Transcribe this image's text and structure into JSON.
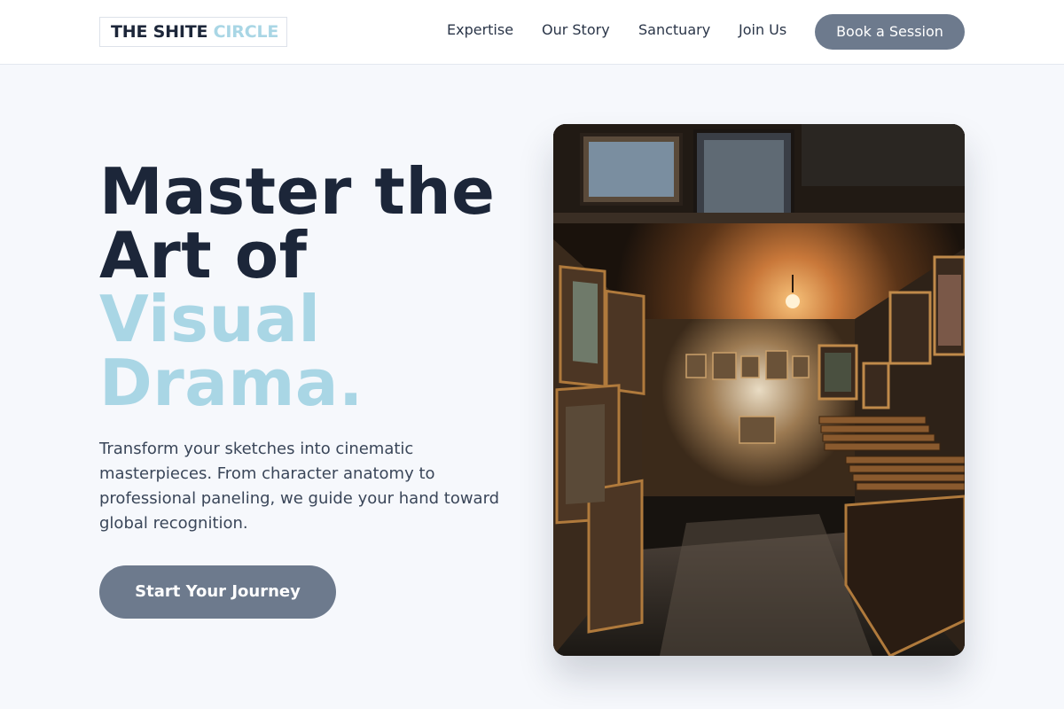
{
  "brand": {
    "word_dark": "THE SHITE",
    "word_light": "CIRCLE"
  },
  "nav": {
    "links": [
      "Expertise",
      "Our Story",
      "Sanctuary",
      "Join Us"
    ],
    "cta_label": "Book a Session"
  },
  "hero": {
    "title_dark": [
      "Master the",
      "Art of"
    ],
    "title_light": [
      "Visual",
      "Drama."
    ],
    "description": "Transform your sketches into cinematic masterpieces. From character anatomy to professional paneling, we guide your hand toward global recognition.",
    "cta_label": "Start Your Journey",
    "image_subject": "art-gallery-corridor-photo"
  },
  "colors": {
    "text_dark": "#1c2639",
    "accent_light_blue": "#a9d6e5",
    "button_slate": "#6d7a8d",
    "background": "#f6f8fc"
  }
}
